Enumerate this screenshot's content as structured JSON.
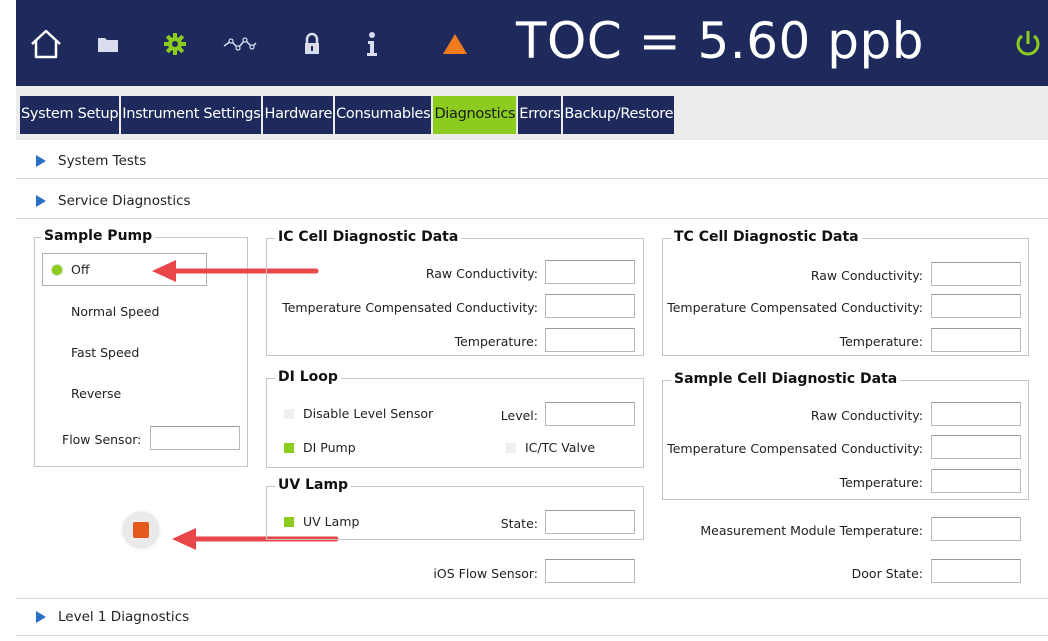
{
  "topbar": {
    "reading": "TOC = 5.60 ppb",
    "icons": [
      "home-icon",
      "folder-icon",
      "gear-icon",
      "trend-icon",
      "lock-icon",
      "info-icon",
      "warning-icon",
      "power-icon"
    ],
    "colors": {
      "bar": "#1e2a5c",
      "accent_green": "#8ccc1e",
      "warning": "#f07a1e"
    }
  },
  "tabs": [
    {
      "label": "System Setup",
      "active": false
    },
    {
      "label": "Instrument Settings",
      "active": false
    },
    {
      "label": "Hardware",
      "active": false
    },
    {
      "label": "Consumables",
      "active": false
    },
    {
      "label": "Diagnostics",
      "active": true
    },
    {
      "label": "Errors",
      "active": false
    },
    {
      "label": "Backup/Restore",
      "active": false
    }
  ],
  "sections": {
    "system_tests": "System Tests",
    "service_diagnostics": "Service Diagnostics",
    "level1": "Level 1 Diagnostics"
  },
  "sample_pump": {
    "title": "Sample Pump",
    "options": [
      "Off",
      "Normal Speed",
      "Fast Speed",
      "Reverse"
    ],
    "selected": "Off",
    "flow_sensor_label": "Flow Sensor:",
    "flow_sensor_value": ""
  },
  "ic_cell": {
    "title": "IC Cell Diagnostic Data",
    "raw": "Raw Conductivity:",
    "temp_comp": "Temperature Compensated Conductivity:",
    "temp": "Temperature:"
  },
  "tc_cell": {
    "title": "TC Cell Diagnostic Data",
    "raw": "Raw Conductivity:",
    "temp_comp": "Temperature Compensated Conductivity:",
    "temp": "Temperature:"
  },
  "di_loop": {
    "title": "DI Loop",
    "disable_level_sensor": "Disable Level Sensor",
    "level_label": "Level:",
    "di_pump": "DI Pump",
    "ictc_valve": "IC/TC Valve"
  },
  "sample_cell": {
    "title": "Sample Cell Diagnostic Data",
    "raw": "Raw Conductivity:",
    "temp_comp": "Temperature Compensated Conductivity:",
    "temp": "Temperature:"
  },
  "uv_lamp": {
    "title": "UV Lamp",
    "uv_lamp_label": "UV Lamp",
    "state_label": "State:"
  },
  "ios_flow_sensor": "iOS Flow Sensor:",
  "measurement_module_temperature": "Measurement Module Temperature:",
  "door_state": "Door State:"
}
